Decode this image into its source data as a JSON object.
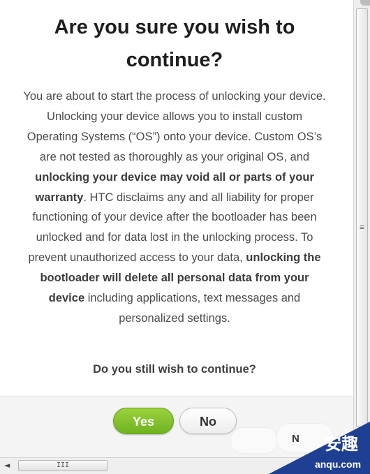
{
  "dialog": {
    "title": "Are you sure you wish to continue?",
    "body": {
      "p1": "You are about to start the process of unlocking your device. Unlocking your device allows you to install custom Operating Systems (“OS”) onto your device. Custom OS’s are not tested as thoroughly as your original OS, and ",
      "b1": "unlocking your device may void all or parts of your warranty",
      "p2": ". HTC disclaims any and all liability for proper functioning of your device after the bootloader has been unlocked and for data lost in the unlocking process. To prevent unauthorized access to your data, ",
      "b2": "unlocking the bootloader will delete all personal data from your device",
      "p3": " including applications, text messages and personalized settings."
    },
    "question": "Do you still wish to continue?",
    "buttons": {
      "yes_label": "Yes",
      "no_label": "No"
    },
    "ghost_text": "N"
  },
  "scrollbars": {
    "vertical_grip": "≡",
    "horizontal_grip": "III",
    "left_arrow": "◄"
  },
  "watermark": {
    "logo": "安趣",
    "url": "anqu.com"
  },
  "colors": {
    "yes_button": "#7dbf2a",
    "watermark_bg": "#1f3f92",
    "title_text": "#1e1e1e",
    "body_text": "#4a4a4a"
  }
}
